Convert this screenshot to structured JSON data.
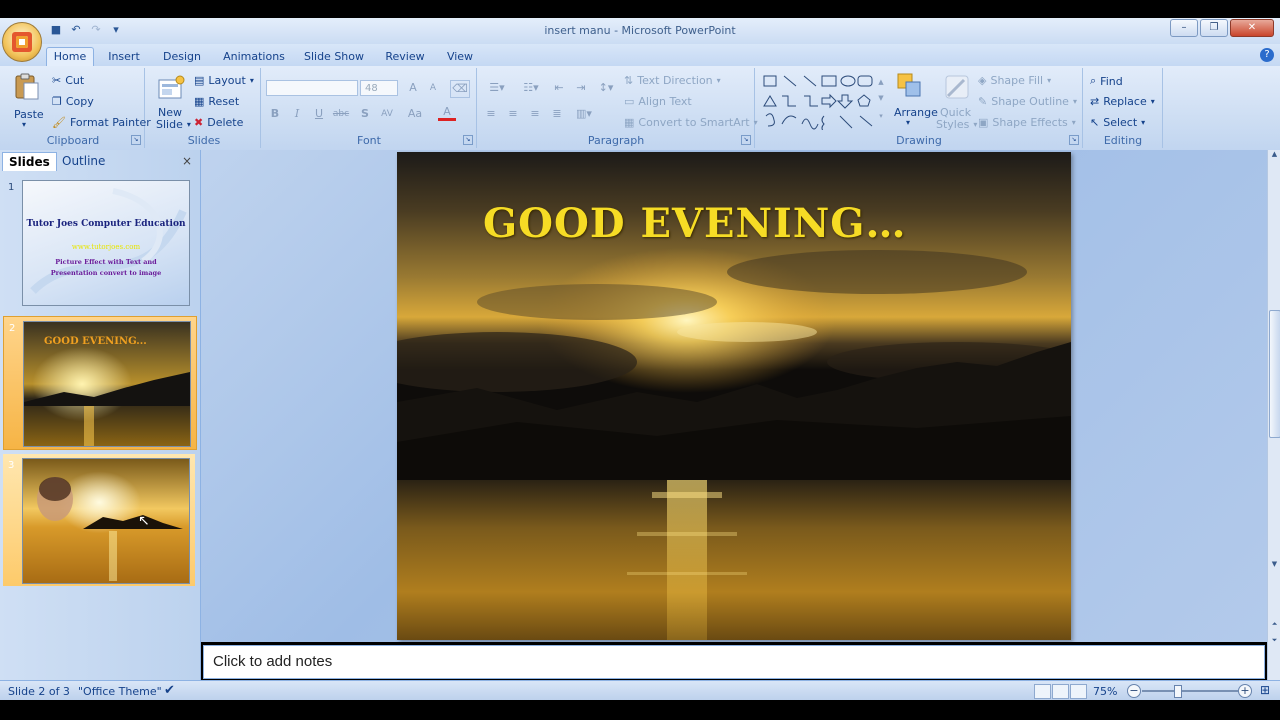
{
  "window": {
    "title": "insert manu - Microsoft PowerPoint",
    "buttons": {
      "minimize": "–",
      "restore": "❐",
      "close": "✕"
    }
  },
  "qat_icons": [
    "save-icon",
    "undo-icon",
    "redo-icon",
    "customize-icon"
  ],
  "tabs": [
    "Home",
    "Insert",
    "Design",
    "Animations",
    "Slide Show",
    "Review",
    "View"
  ],
  "active_tab": "Home",
  "ribbon": {
    "clipboard": {
      "label": "Clipboard",
      "paste": "Paste",
      "cut": "Cut",
      "copy": "Copy",
      "format_painter": "Format Painter"
    },
    "slides": {
      "label": "Slides",
      "new_slide_line1": "New",
      "new_slide_line2": "Slide",
      "layout": "Layout",
      "reset": "Reset",
      "delete": "Delete"
    },
    "font": {
      "label": "Font",
      "size": "48",
      "bold": "B",
      "italic": "I",
      "underline": "U",
      "strike": "abc",
      "shadow": "S",
      "spacing": "AV",
      "case": "Aa",
      "color": "A",
      "grow": "A",
      "shrink": "A"
    },
    "paragraph": {
      "label": "Paragraph",
      "text_direction": "Text Direction",
      "align_text": "Align Text",
      "convert_smartart": "Convert to SmartArt"
    },
    "drawing": {
      "label": "Drawing",
      "arrange": "Arrange",
      "quick_styles_1": "Quick",
      "quick_styles_2": "Styles",
      "shape_fill": "Shape Fill",
      "shape_outline": "Shape Outline",
      "shape_effects": "Shape Effects"
    },
    "editing": {
      "label": "Editing",
      "find": "Find",
      "replace": "Replace",
      "select": "Select"
    }
  },
  "left_pane": {
    "tabs": [
      "Slides",
      "Outline"
    ],
    "close": "×",
    "thumbnails": [
      {
        "num": "1",
        "line1": "Tutor Joes Computer Education",
        "line2": "www.tutorjoes.com",
        "line3": "Picture Effect with Text and",
        "line4": "Presentation convert to image"
      },
      {
        "num": "2",
        "title": "GOOD EVENING..."
      },
      {
        "num": "3"
      }
    ]
  },
  "slide": {
    "title": "GOOD EVENING…"
  },
  "notes": {
    "placeholder": "Click to add notes"
  },
  "status": {
    "slide": "Slide 2 of 3",
    "theme": "\"Office Theme\"",
    "zoom": "75%",
    "zoom_minus": "−",
    "zoom_plus": "+"
  }
}
